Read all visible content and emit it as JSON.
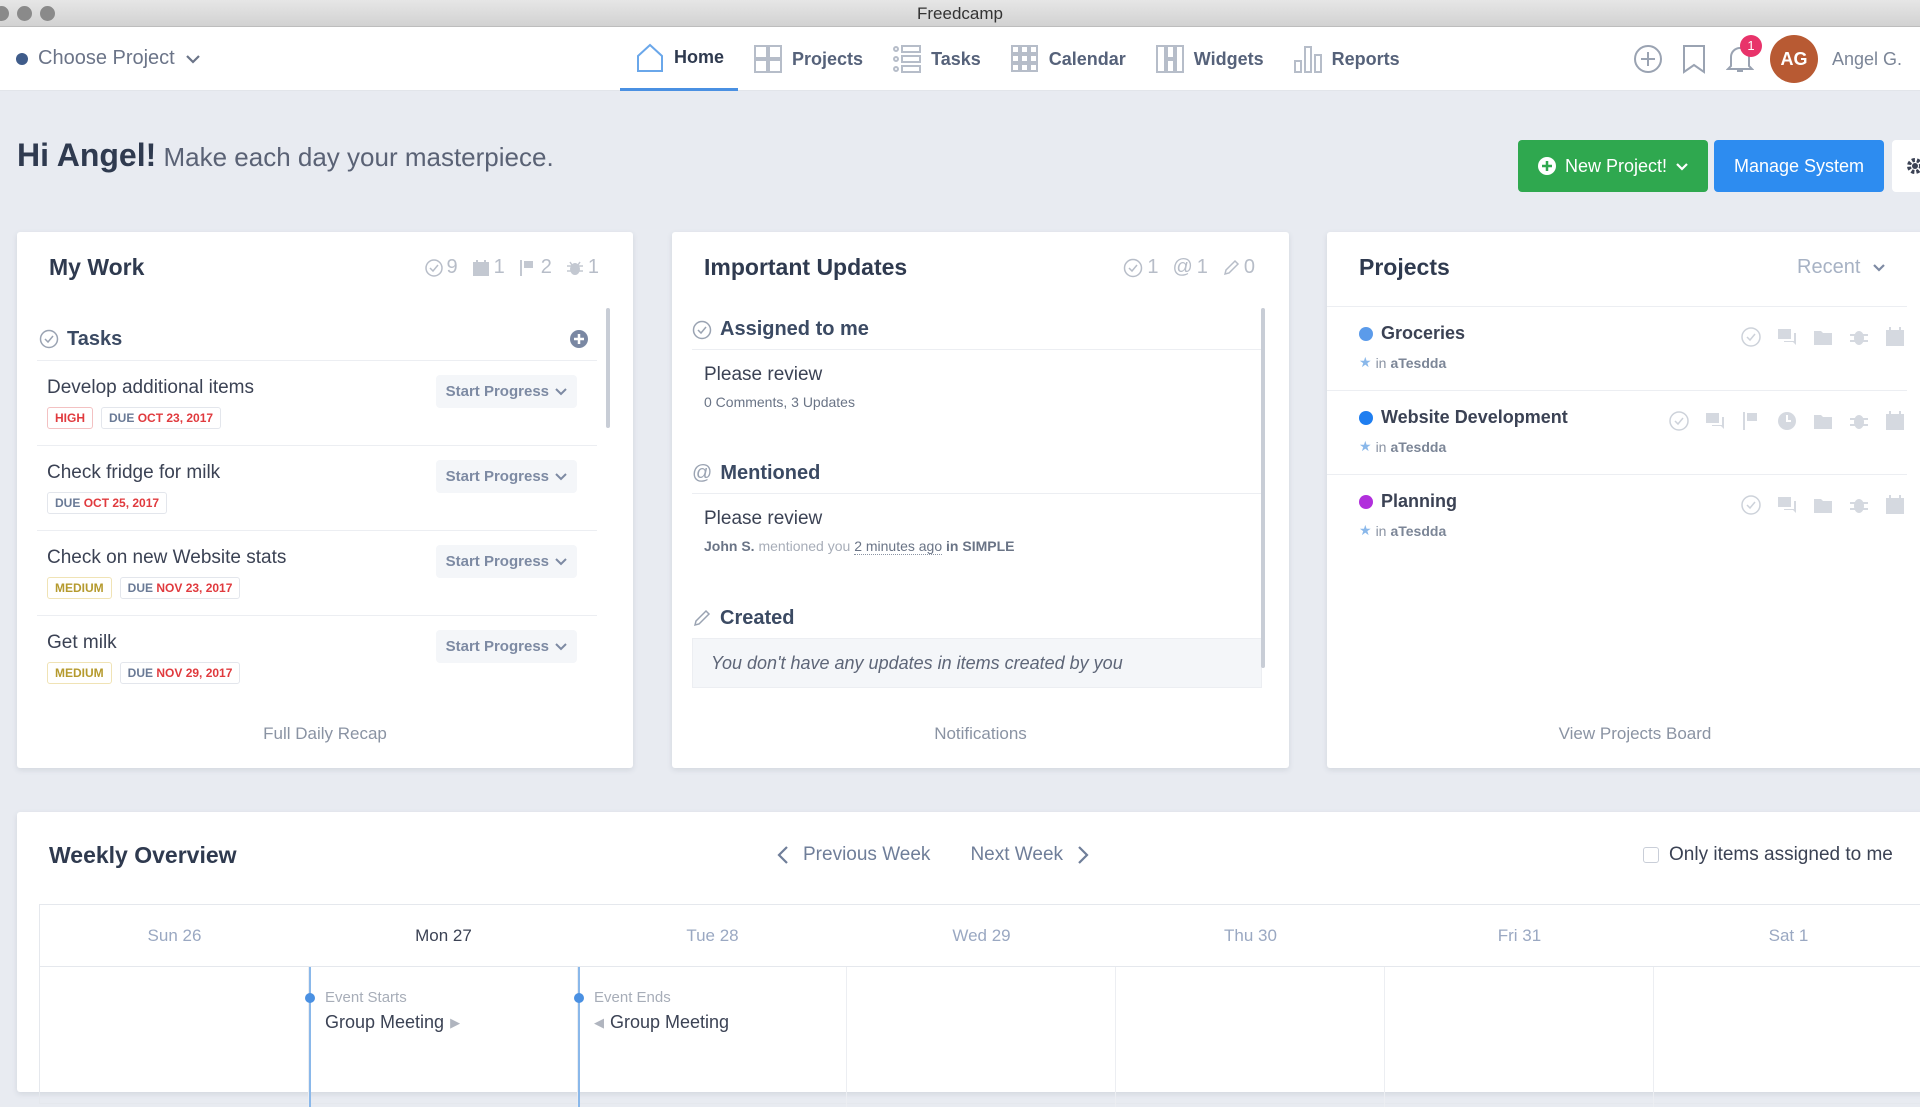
{
  "window": {
    "title": "Freedcamp"
  },
  "topnav": {
    "project_selector": "Choose Project",
    "items": [
      {
        "label": "Home",
        "icon": "home-icon",
        "active": true
      },
      {
        "label": "Projects",
        "icon": "projects-icon"
      },
      {
        "label": "Tasks",
        "icon": "tasks-icon"
      },
      {
        "label": "Calendar",
        "icon": "calendar-icon"
      },
      {
        "label": "Widgets",
        "icon": "widgets-icon"
      },
      {
        "label": "Reports",
        "icon": "reports-icon"
      }
    ],
    "notification_count": "1",
    "avatar_initials": "AG",
    "user_name": "Angel G."
  },
  "greeting": {
    "name": "Hi Angel!",
    "message": "Make each day your masterpiece."
  },
  "actions": {
    "new_project": "New Project!",
    "manage_system": "Manage System"
  },
  "my_work": {
    "title": "My Work",
    "counts": {
      "tasks": "9",
      "events": "1",
      "milestones": "2",
      "issues": "1"
    },
    "section": "Tasks",
    "tasks": [
      {
        "name": "Develop additional items",
        "priority": "HIGH",
        "due_label": "DUE",
        "due": "OCT 23, 2017",
        "action": "Start Progress"
      },
      {
        "name": "Check fridge for milk",
        "priority": "",
        "due_label": "DUE",
        "due": "OCT 25, 2017",
        "action": "Start Progress"
      },
      {
        "name": "Check on new Website stats",
        "priority": "MEDIUM",
        "due_label": "DUE",
        "due": "NOV 23, 2017",
        "action": "Start Progress"
      },
      {
        "name": "Get milk",
        "priority": "MEDIUM",
        "due_label": "DUE",
        "due": "NOV 29, 2017",
        "action": "Start Progress"
      }
    ],
    "footer": "Full Daily Recap"
  },
  "updates": {
    "title": "Important Updates",
    "counts": {
      "assigned": "1",
      "mentioned": "1",
      "created": "0"
    },
    "assigned": {
      "heading": "Assigned to me",
      "item_title": "Please review",
      "item_sub": "0 Comments, 3 Updates"
    },
    "mentioned": {
      "heading": "Mentioned",
      "item_title": "Please review",
      "who": "John S.",
      "verb": "mentioned you",
      "when": "2 minutes ago",
      "in": "in",
      "where": "SIMPLE"
    },
    "created": {
      "heading": "Created",
      "empty": "You don't have any updates in items created by you"
    },
    "footer": "Notifications"
  },
  "projects": {
    "title": "Projects",
    "sort": "Recent",
    "items": [
      {
        "name": "Groceries",
        "color": "#5b9bea",
        "group": "aTesdda",
        "in_label": "in"
      },
      {
        "name": "Website Development",
        "color": "#1f7ef0",
        "group": "aTesdda",
        "in_label": "in"
      },
      {
        "name": "Planning",
        "color": "#b12fdc",
        "group": "aTesdda",
        "in_label": "in"
      }
    ],
    "footer": "View Projects Board"
  },
  "weekly": {
    "title": "Weekly Overview",
    "prev": "Previous Week",
    "next": "Next Week",
    "only_mine": "Only items assigned to me",
    "days": [
      "Sun 26",
      "Mon 27",
      "Tue 28",
      "Wed 29",
      "Thu 30",
      "Fri 31",
      "Sat 1"
    ],
    "today_index": 1,
    "events": [
      {
        "label": "Event Starts",
        "title": "Group Meeting"
      },
      {
        "label": "Event Ends",
        "title": "Group Meeting"
      }
    ]
  }
}
